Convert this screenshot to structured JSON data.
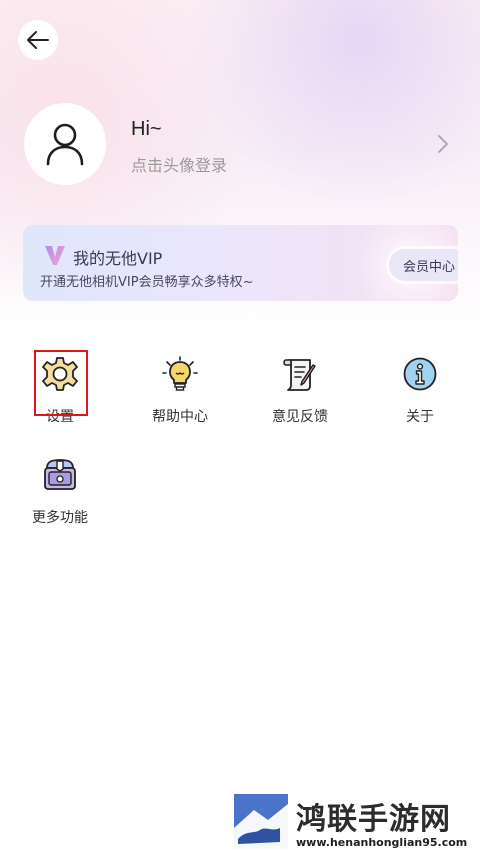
{
  "header": {
    "back_icon": "arrow-left-icon"
  },
  "profile": {
    "avatar_icon": "user-outline-icon",
    "greeting": "Hi~",
    "login_hint": "点击头像登录",
    "chevron_icon": "chevron-right-icon"
  },
  "vip": {
    "logo_icon": "v-logo-icon",
    "title": "我的无他VIP",
    "subtitle": "开通无他相机VIP会员畅享众多特权~",
    "button_label": "会员中心"
  },
  "menu": {
    "items": [
      {
        "label": "设置",
        "icon": "gear-icon"
      },
      {
        "label": "帮助中心",
        "icon": "lightbulb-icon"
      },
      {
        "label": "意见反馈",
        "icon": "feedback-scroll-icon"
      },
      {
        "label": "关于",
        "icon": "info-icon"
      },
      {
        "label": "更多功能",
        "icon": "treasure-box-icon"
      }
    ]
  },
  "watermark": {
    "title": "鸿联手游网",
    "url": "www.henanhonglian95.com"
  },
  "colors": {
    "highlight": "#e1141b",
    "accent_blue": "#4a73c9",
    "icon_yellow": "#f5d66a"
  }
}
